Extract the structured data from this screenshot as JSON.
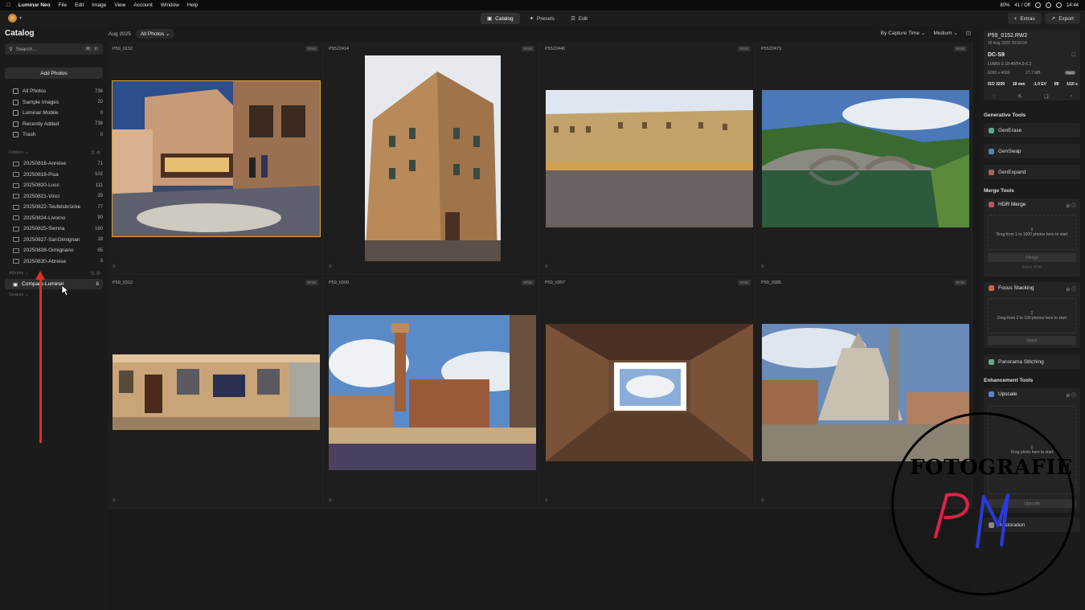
{
  "menubar": {
    "app": "Luminar Neo",
    "items": [
      "File",
      "Edit",
      "Image",
      "View",
      "Account",
      "Window",
      "Help"
    ],
    "status": "80%",
    "network": "41 / Off",
    "clock": "14:44"
  },
  "toolbar": {
    "modes": [
      {
        "label": "Catalog",
        "active": true
      },
      {
        "label": "Presets",
        "active": false
      },
      {
        "label": "Edit",
        "active": false
      }
    ],
    "extras": "Extras",
    "export": "Export"
  },
  "sidebar": {
    "title": "Catalog",
    "search_placeholder": "Search...",
    "add_photos": "Add Photos",
    "nav": [
      {
        "label": "All Photos",
        "count": "736"
      },
      {
        "label": "Sample Images",
        "count": "20"
      },
      {
        "label": "Luminar Mobile",
        "count": "0"
      },
      {
        "label": "Recently Added",
        "count": "736"
      },
      {
        "label": "Trash",
        "count": "0"
      }
    ],
    "folders_label": "Folders",
    "folders": [
      {
        "label": "20250816-Anreise",
        "count": "71"
      },
      {
        "label": "20250818-Pisa",
        "count": "102"
      },
      {
        "label": "20250820-Lucc",
        "count": "111"
      },
      {
        "label": "20250821-Vinci",
        "count": "39"
      },
      {
        "label": "20250822-Teufelsbrücke",
        "count": "77"
      },
      {
        "label": "20250824-Livorno",
        "count": "90"
      },
      {
        "label": "20250825-Sienna",
        "count": "160"
      },
      {
        "label": "20250827-SanGimignan",
        "count": "18"
      },
      {
        "label": "20250828-Gimignano",
        "count": "65"
      },
      {
        "label": "20250830-Abreise",
        "count": "3"
      }
    ],
    "albums_label": "Albums",
    "album": {
      "label": "Compare-Luminar",
      "count": "8"
    },
    "spaces_label": "Spaces"
  },
  "content": {
    "date": "Aug 2025",
    "filter": "All Photos",
    "sort": "By Capture Time",
    "size": "Medium",
    "photos": [
      {
        "name": "P59_0152",
        "tag": "RAW"
      },
      {
        "name": "P5522414",
        "tag": "RAW"
      },
      {
        "name": "P5522446",
        "tag": "RAW"
      },
      {
        "name": "P5522473",
        "tag": "RAW"
      },
      {
        "name": "P59_0312",
        "tag": "RAW"
      },
      {
        "name": "P59_0309",
        "tag": "RAW"
      },
      {
        "name": "P59_0357",
        "tag": "RAW"
      },
      {
        "name": "P59_0385",
        "tag": "RAW"
      }
    ]
  },
  "info": {
    "filename": "P59_0152.RW2",
    "datetime": "16 Aug 2025 20:50:04",
    "camera": "DC-S9",
    "lens": "LUMIX S 18-40/F4.5-6.3",
    "dimensions": "6000 x 4000",
    "filesize": "27,7 MB",
    "format": "RW2",
    "iso": "ISO 3200",
    "focal": "18 mm",
    "ev": "-1.0 EV",
    "aperture": "f/8",
    "shutter": "1/10 s"
  },
  "tools": {
    "generative_title": "Generative Tools",
    "generative": [
      "GenErase",
      "GenSwap",
      "GenExpand"
    ],
    "merge_title": "Merge Tools",
    "hdr": {
      "title": "HDR Merge",
      "drop": "Drag from 1 to 1000 photos here to start",
      "button": "Merge",
      "link": "Batch HDR"
    },
    "focus": {
      "title": "Focus Stacking",
      "drop": "Drag from 2 to 100 photos here to start",
      "button": "Stack"
    },
    "panorama": "Panorama Stitching",
    "enhancement_title": "Enhancement Tools",
    "upscale": {
      "title": "Upscale",
      "drop": "Drag photo here to start",
      "button": "Upscale"
    },
    "restoration": "Restoration"
  },
  "watermark": {
    "text": "FOTOGRAFIE",
    "monogram": "PM"
  }
}
